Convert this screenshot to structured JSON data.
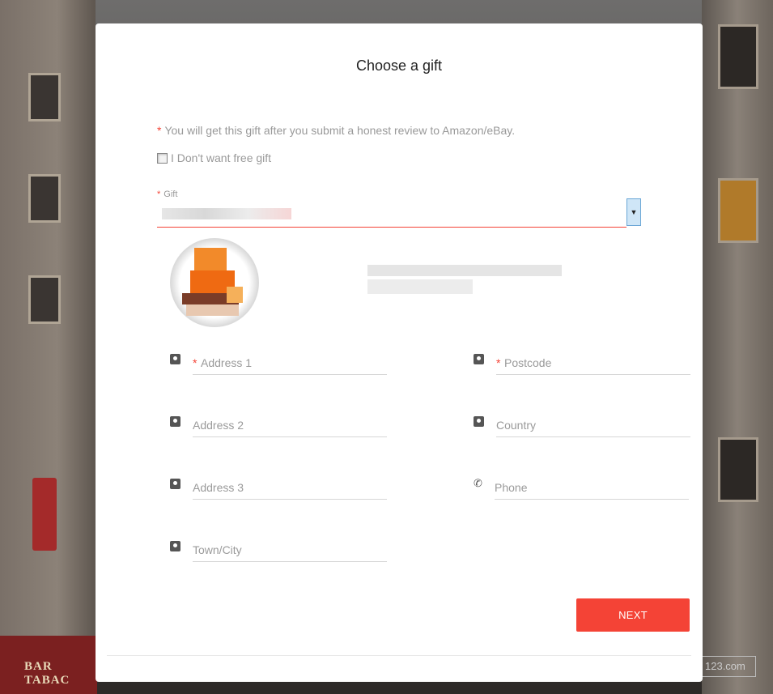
{
  "modal": {
    "title": "Choose a gift",
    "note": "You will get this gift after you submit a honest review to Amazon/eBay.",
    "optout_label": "I Don't want free gift",
    "gift_label": "Gift",
    "next_label": "NEXT"
  },
  "form": {
    "address1_placeholder": "Address 1",
    "postcode_placeholder": "Postcode",
    "address2_placeholder": "Address 2",
    "country_placeholder": "Country",
    "address3_placeholder": "Address 3",
    "phone_placeholder": "Phone",
    "town_placeholder": "Town/City"
  },
  "background": {
    "awning_text": "BAR TABAC",
    "watermark_text": "123.com"
  },
  "colors": {
    "accent": "#f44336",
    "placeholder": "#9a9a9a"
  },
  "icons": {
    "field": "contact-card-icon",
    "phone": "phone-icon",
    "dropdown": "chevron-down-icon"
  }
}
